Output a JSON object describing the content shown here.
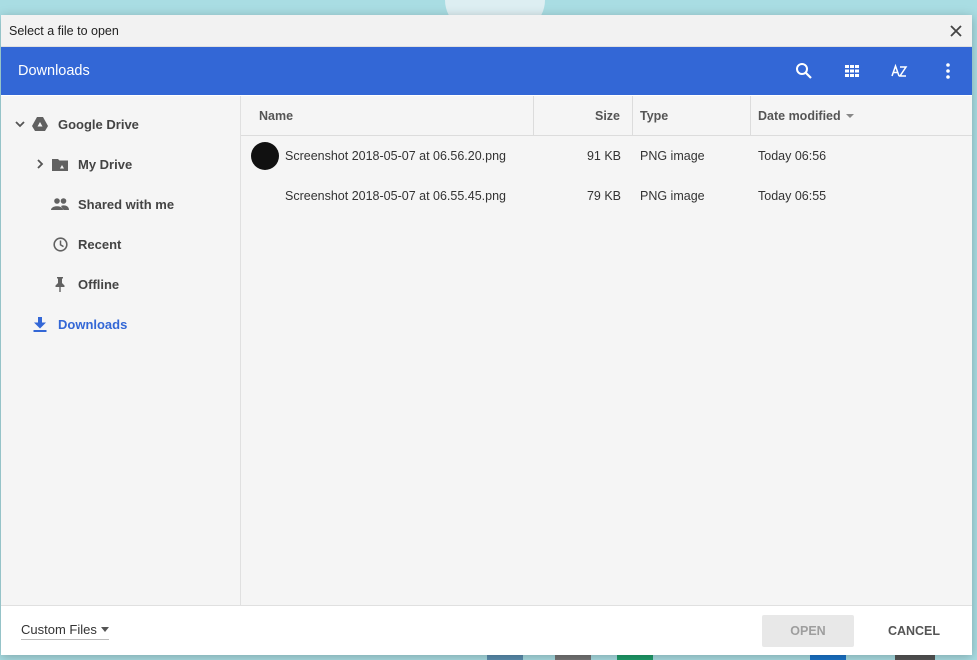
{
  "window": {
    "title": "Select a file to open"
  },
  "toolbar": {
    "heading": "Downloads",
    "buttons": [
      "search-icon",
      "grid-view-icon",
      "sort-az-icon",
      "more-vert-icon"
    ]
  },
  "sidebar": {
    "items": [
      {
        "label": "Google Drive",
        "icon": "google-drive-icon",
        "expanded": true
      },
      {
        "label": "My Drive",
        "icon": "shared-folder-icon",
        "collapsed": true
      },
      {
        "label": "Shared with me",
        "icon": "people-icon"
      },
      {
        "label": "Recent",
        "icon": "clock-icon"
      },
      {
        "label": "Offline",
        "icon": "pin-icon"
      },
      {
        "label": "Downloads",
        "icon": "download-icon",
        "active": true
      }
    ]
  },
  "table": {
    "headers": {
      "name": "Name",
      "size": "Size",
      "type": "Type",
      "date": "Date modified"
    },
    "rows": [
      {
        "name": "Screenshot 2018-05-07 at 06.56.20.png",
        "size": "91 KB",
        "type": "PNG image",
        "date": "Today 06:56",
        "has_thumb": true
      },
      {
        "name": "Screenshot 2018-05-07 at 06.55.45.png",
        "size": "79 KB",
        "type": "PNG image",
        "date": "Today 06:55",
        "has_thumb": false
      }
    ]
  },
  "footer": {
    "filter_label": "Custom Files",
    "open_label": "OPEN",
    "cancel_label": "CANCEL"
  },
  "colors": {
    "accent": "#3367d6",
    "desktop": "#a9dde3"
  }
}
